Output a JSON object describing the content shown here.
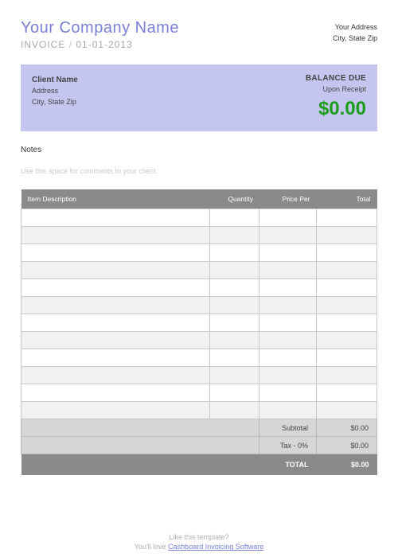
{
  "header": {
    "company_name": "Your Company Name",
    "invoice_label": "INVOICE",
    "invoice_date": "01-01-2013",
    "your_address": "Your Address",
    "your_city_state_zip": "City, State Zip"
  },
  "client": {
    "name": "Client Name",
    "address": "Address",
    "city_state_zip": "City, State Zip",
    "balance_due_label": "BALANCE DUE",
    "balance_due_terms": "Upon Receipt",
    "balance_amount": "$0.00"
  },
  "notes": {
    "label": "Notes",
    "placeholder": "Use this space for comments to your client."
  },
  "table": {
    "headers": {
      "description": "Item Description",
      "quantity": "Quantity",
      "price": "Price Per",
      "total": "Total"
    },
    "summary": {
      "subtotal_label": "Subtotal",
      "subtotal_value": "$0.00",
      "tax_label": "Tax - 0%",
      "tax_value": "$0.00",
      "total_label": "TOTAL",
      "total_value": "$0.00"
    }
  },
  "footer": {
    "line1": "Like this template?",
    "line2_prefix": "You'll love ",
    "link_text": "Cashboard Invoicing Software"
  }
}
